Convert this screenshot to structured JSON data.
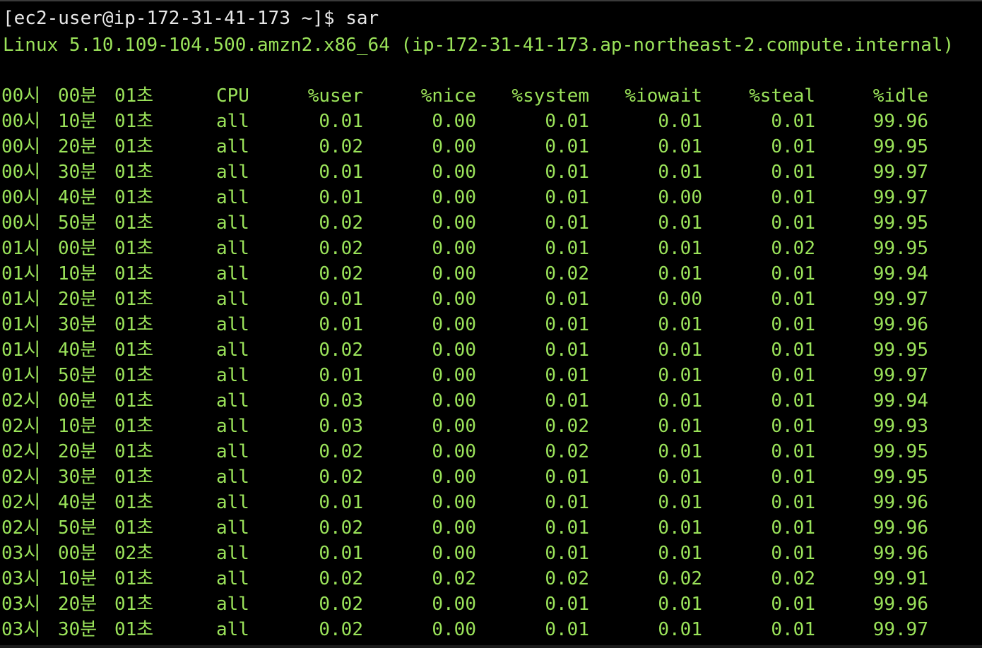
{
  "colors": {
    "background": "#000000",
    "prompt_text": "#e8e8e8",
    "output_text": "#9be35a"
  },
  "terminal": {
    "prompt": "[ec2-user@ip-172-31-41-173 ~]$ sar",
    "sysinfo": "Linux 5.10.109-104.500.amzn2.x86_64 (ip-172-31-41-173.ap-northeast-2.compute.internal)"
  },
  "table": {
    "header": {
      "hour": "00시",
      "min": "00분",
      "sec": "01초",
      "cpu": "CPU",
      "user": "%user",
      "nice": "%nice",
      "system": "%system",
      "iowait": "%iowait",
      "steal": "%steal",
      "idle": "%idle"
    },
    "rows": [
      {
        "hour": "00시",
        "min": "10분",
        "sec": "01초",
        "cpu": "all",
        "user": "0.01",
        "nice": "0.00",
        "system": "0.01",
        "iowait": "0.01",
        "steal": "0.01",
        "idle": "99.96"
      },
      {
        "hour": "00시",
        "min": "20분",
        "sec": "01초",
        "cpu": "all",
        "user": "0.02",
        "nice": "0.00",
        "system": "0.01",
        "iowait": "0.01",
        "steal": "0.01",
        "idle": "99.95"
      },
      {
        "hour": "00시",
        "min": "30분",
        "sec": "01초",
        "cpu": "all",
        "user": "0.01",
        "nice": "0.00",
        "system": "0.01",
        "iowait": "0.01",
        "steal": "0.01",
        "idle": "99.97"
      },
      {
        "hour": "00시",
        "min": "40분",
        "sec": "01초",
        "cpu": "all",
        "user": "0.01",
        "nice": "0.00",
        "system": "0.01",
        "iowait": "0.00",
        "steal": "0.01",
        "idle": "99.97"
      },
      {
        "hour": "00시",
        "min": "50분",
        "sec": "01초",
        "cpu": "all",
        "user": "0.02",
        "nice": "0.00",
        "system": "0.01",
        "iowait": "0.01",
        "steal": "0.01",
        "idle": "99.95"
      },
      {
        "hour": "01시",
        "min": "00분",
        "sec": "01초",
        "cpu": "all",
        "user": "0.02",
        "nice": "0.00",
        "system": "0.01",
        "iowait": "0.01",
        "steal": "0.02",
        "idle": "99.95"
      },
      {
        "hour": "01시",
        "min": "10분",
        "sec": "01초",
        "cpu": "all",
        "user": "0.02",
        "nice": "0.00",
        "system": "0.02",
        "iowait": "0.01",
        "steal": "0.01",
        "idle": "99.94"
      },
      {
        "hour": "01시",
        "min": "20분",
        "sec": "01초",
        "cpu": "all",
        "user": "0.01",
        "nice": "0.00",
        "system": "0.01",
        "iowait": "0.00",
        "steal": "0.01",
        "idle": "99.97"
      },
      {
        "hour": "01시",
        "min": "30분",
        "sec": "01초",
        "cpu": "all",
        "user": "0.01",
        "nice": "0.00",
        "system": "0.01",
        "iowait": "0.01",
        "steal": "0.01",
        "idle": "99.96"
      },
      {
        "hour": "01시",
        "min": "40분",
        "sec": "01초",
        "cpu": "all",
        "user": "0.02",
        "nice": "0.00",
        "system": "0.01",
        "iowait": "0.01",
        "steal": "0.01",
        "idle": "99.95"
      },
      {
        "hour": "01시",
        "min": "50분",
        "sec": "01초",
        "cpu": "all",
        "user": "0.01",
        "nice": "0.00",
        "system": "0.01",
        "iowait": "0.01",
        "steal": "0.01",
        "idle": "99.97"
      },
      {
        "hour": "02시",
        "min": "00분",
        "sec": "01초",
        "cpu": "all",
        "user": "0.03",
        "nice": "0.00",
        "system": "0.01",
        "iowait": "0.01",
        "steal": "0.01",
        "idle": "99.94"
      },
      {
        "hour": "02시",
        "min": "10분",
        "sec": "01초",
        "cpu": "all",
        "user": "0.03",
        "nice": "0.00",
        "system": "0.02",
        "iowait": "0.01",
        "steal": "0.01",
        "idle": "99.93"
      },
      {
        "hour": "02시",
        "min": "20분",
        "sec": "01초",
        "cpu": "all",
        "user": "0.02",
        "nice": "0.00",
        "system": "0.02",
        "iowait": "0.01",
        "steal": "0.01",
        "idle": "99.95"
      },
      {
        "hour": "02시",
        "min": "30분",
        "sec": "01초",
        "cpu": "all",
        "user": "0.02",
        "nice": "0.00",
        "system": "0.01",
        "iowait": "0.01",
        "steal": "0.01",
        "idle": "99.95"
      },
      {
        "hour": "02시",
        "min": "40분",
        "sec": "01초",
        "cpu": "all",
        "user": "0.01",
        "nice": "0.00",
        "system": "0.01",
        "iowait": "0.01",
        "steal": "0.01",
        "idle": "99.96"
      },
      {
        "hour": "02시",
        "min": "50분",
        "sec": "01초",
        "cpu": "all",
        "user": "0.02",
        "nice": "0.00",
        "system": "0.01",
        "iowait": "0.01",
        "steal": "0.01",
        "idle": "99.96"
      },
      {
        "hour": "03시",
        "min": "00분",
        "sec": "02초",
        "cpu": "all",
        "user": "0.01",
        "nice": "0.00",
        "system": "0.01",
        "iowait": "0.01",
        "steal": "0.01",
        "idle": "99.96"
      },
      {
        "hour": "03시",
        "min": "10분",
        "sec": "01초",
        "cpu": "all",
        "user": "0.02",
        "nice": "0.02",
        "system": "0.02",
        "iowait": "0.02",
        "steal": "0.02",
        "idle": "99.91"
      },
      {
        "hour": "03시",
        "min": "20분",
        "sec": "01초",
        "cpu": "all",
        "user": "0.02",
        "nice": "0.00",
        "system": "0.01",
        "iowait": "0.01",
        "steal": "0.01",
        "idle": "99.96"
      },
      {
        "hour": "03시",
        "min": "30분",
        "sec": "01초",
        "cpu": "all",
        "user": "0.02",
        "nice": "0.00",
        "system": "0.01",
        "iowait": "0.01",
        "steal": "0.01",
        "idle": "99.97"
      }
    ]
  }
}
